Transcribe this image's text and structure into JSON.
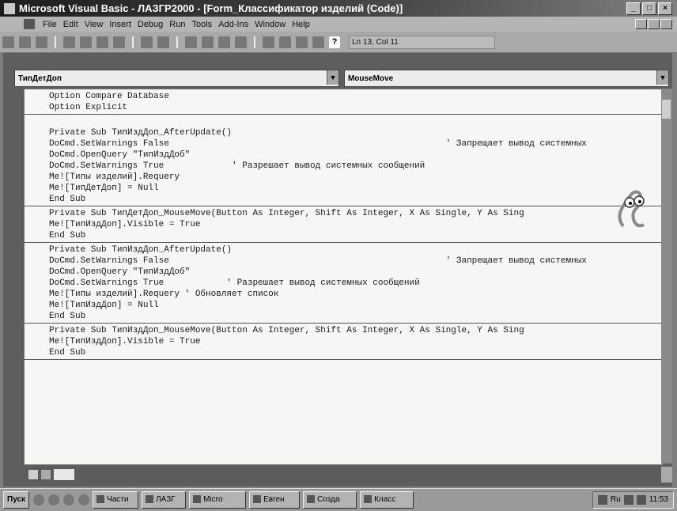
{
  "window": {
    "title": "Microsoft Visual Basic - ЛАЗГР2000 - [Form_Классификатор изделий (Code)]",
    "buttons": [
      "_",
      "□",
      "×"
    ]
  },
  "menu": {
    "items": [
      "File",
      "Edit",
      "View",
      "Insert",
      "Debug",
      "Run",
      "Tools",
      "Add-Ins",
      "Window",
      "Help"
    ]
  },
  "toolbar": {
    "help_label": "?",
    "cursor_position": "Ln 13, Col 11"
  },
  "object_combo": {
    "value": "ТипДетДоп"
  },
  "procedure_combo": {
    "value": "MouseMove"
  },
  "code": {
    "procs": [
      {
        "lines": [
          {
            "code": "Option Compare Database"
          },
          {
            "code": "Option Explicit"
          }
        ]
      },
      {
        "lines": [
          {
            "code": ""
          },
          {
            "code": "Private Sub ТипИздДоп_AfterUpdate()"
          },
          {
            "code": "DoCmd.SetWarnings False",
            "comment": "' Запрещает вывод системных",
            "ccol": 76
          },
          {
            "code": "DoCmd.OpenQuery \"ТипИздДоб\""
          },
          {
            "code": "DoCmd.SetWarnings True",
            "comment": "' Разрешает вывод системных сообщений",
            "ccol": 35
          },
          {
            "code": "Me![Типы изделий].Requery"
          },
          {
            "code": "Me![ТипДетДоп] = Null"
          },
          {
            "code": "End Sub"
          }
        ]
      },
      {
        "lines": [
          {
            "code": "Private Sub ТипДетДоп_MouseMove(Button As Integer, Shift As Integer, X As Single, Y As Sing"
          },
          {
            "code": "Me![ТипИздДоп].Visible = True"
          },
          {
            "code": "End Sub"
          }
        ]
      },
      {
        "lines": [
          {
            "code": "Private Sub ТипИздДоп_AfterUpdate()"
          },
          {
            "code": "DoCmd.SetWarnings False",
            "comment": "' Запрещает вывод системных",
            "ccol": 76
          },
          {
            "code": "DoCmd.OpenQuery \"ТипИздДоб\""
          },
          {
            "code": "DoCmd.SetWarnings True",
            "comment": "' Разрешает вывод системных сообщений",
            "ccol": 34
          },
          {
            "code": "Me![Типы изделий].Requery ' Обновляет список"
          },
          {
            "code": "Me![ТипИздДоп] = Null"
          },
          {
            "code": "End Sub"
          }
        ]
      },
      {
        "lines": [
          {
            "code": "Private Sub ТипИздДоп_MouseMove(Button As Integer, Shift As Integer, X As Single, Y As Sing"
          },
          {
            "code": "Me![ТипИздДоп].Visible = True"
          },
          {
            "code": "End Sub"
          }
        ]
      }
    ]
  },
  "taskbar": {
    "start_label": "Пуск",
    "tasks": [
      "Части",
      "ЛАЗГ",
      "Micro",
      "Евген",
      "Созда",
      "Класс"
    ],
    "lang": "Ru",
    "clock": "11:53"
  }
}
